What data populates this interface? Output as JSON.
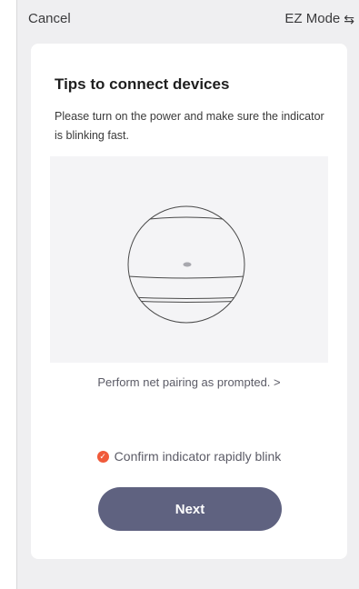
{
  "topbar": {
    "cancel_label": "Cancel",
    "mode_label": "EZ Mode",
    "mode_icon": "swap-arrows-icon"
  },
  "card": {
    "title": "Tips to connect devices",
    "description": "Please turn on the power and make sure the indicator is blinking fast.",
    "pairing_link": "Perform net pairing as prompted. >",
    "confirm_label": "Confirm indicator rapidly blink",
    "confirm_checked": true,
    "next_label": "Next"
  },
  "colors": {
    "background": "#efeff1",
    "card": "#ffffff",
    "accent_check": "#f05a3a",
    "button": "#5f6280"
  }
}
